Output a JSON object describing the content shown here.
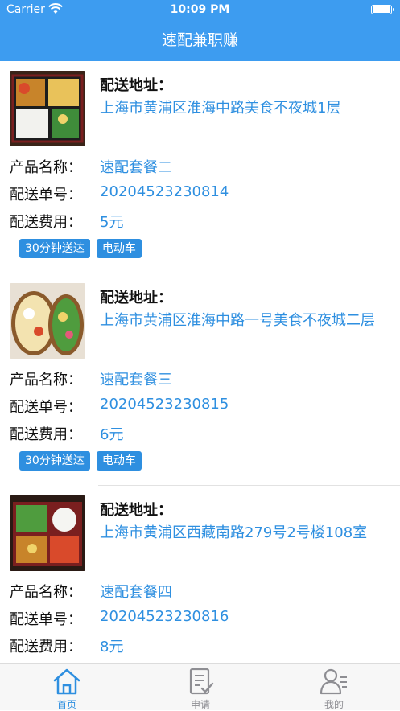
{
  "status_bar": {
    "carrier": "Carrier",
    "time": "10:09 PM"
  },
  "nav": {
    "title": "速配兼职赚"
  },
  "orders": [
    {
      "address_label": "配送地址：",
      "address": "上海市黄浦区淮海中路美食不夜城1层",
      "product_label": "产品名称：",
      "product": "速配套餐二",
      "order_no_label": "配送单号：",
      "order_no": "20204523230814",
      "fee_label": "配送费用：",
      "fee": "5元",
      "tags": [
        "30分钟送达",
        "电动车"
      ]
    },
    {
      "address_label": "配送地址：",
      "address": "上海市黄浦区淮海中路一号美食不夜城二层",
      "product_label": "产品名称：",
      "product": "速配套餐三",
      "order_no_label": "配送单号：",
      "order_no": "20204523230815",
      "fee_label": "配送费用：",
      "fee": "6元",
      "tags": [
        "30分钟送达",
        "电动车"
      ]
    },
    {
      "address_label": "配送地址：",
      "address": "上海市黄浦区西藏南路279号2号楼108室",
      "product_label": "产品名称：",
      "product": "速配套餐四",
      "order_no_label": "配送单号：",
      "order_no": "20204523230816",
      "fee_label": "配送费用：",
      "fee": "8元",
      "tags": []
    }
  ],
  "tab_bar": {
    "items": [
      {
        "label": "首页",
        "icon": "home-icon",
        "active": true
      },
      {
        "label": "申请",
        "icon": "apply-document-icon",
        "active": false
      },
      {
        "label": "我的",
        "icon": "profile-icon",
        "active": false
      }
    ]
  },
  "colors": {
    "accent": "#3d9cf0",
    "link_text": "#2e8fe0",
    "inactive_tab": "#8e8e93"
  }
}
